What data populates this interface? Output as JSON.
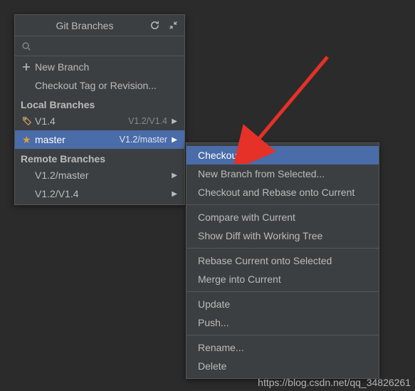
{
  "branches_panel": {
    "title": "Git Branches",
    "search_placeholder": "",
    "new_branch": "New Branch",
    "checkout_tag": "Checkout Tag or Revision...",
    "local_header": "Local Branches",
    "local": [
      {
        "name": "V1.4",
        "tracking": "V1.2/V1.4",
        "icon": "tag"
      },
      {
        "name": "master",
        "tracking": "V1.2/master",
        "icon": "star",
        "selected": true
      }
    ],
    "remote_header": "Remote Branches",
    "remote": [
      {
        "name": "V1.2/master"
      },
      {
        "name": "V1.2/V1.4"
      }
    ]
  },
  "context_menu": {
    "groups": [
      [
        {
          "label": "Checkout",
          "selected": true
        },
        {
          "label": "New Branch from Selected..."
        },
        {
          "label": "Checkout and Rebase onto Current"
        }
      ],
      [
        {
          "label": "Compare with Current"
        },
        {
          "label": "Show Diff with Working Tree"
        }
      ],
      [
        {
          "label": "Rebase Current onto Selected"
        },
        {
          "label": "Merge into Current"
        }
      ],
      [
        {
          "label": "Update"
        },
        {
          "label": "Push..."
        }
      ],
      [
        {
          "label": "Rename..."
        },
        {
          "label": "Delete"
        }
      ]
    ]
  },
  "watermark": "https://blog.csdn.net/qq_34826261"
}
